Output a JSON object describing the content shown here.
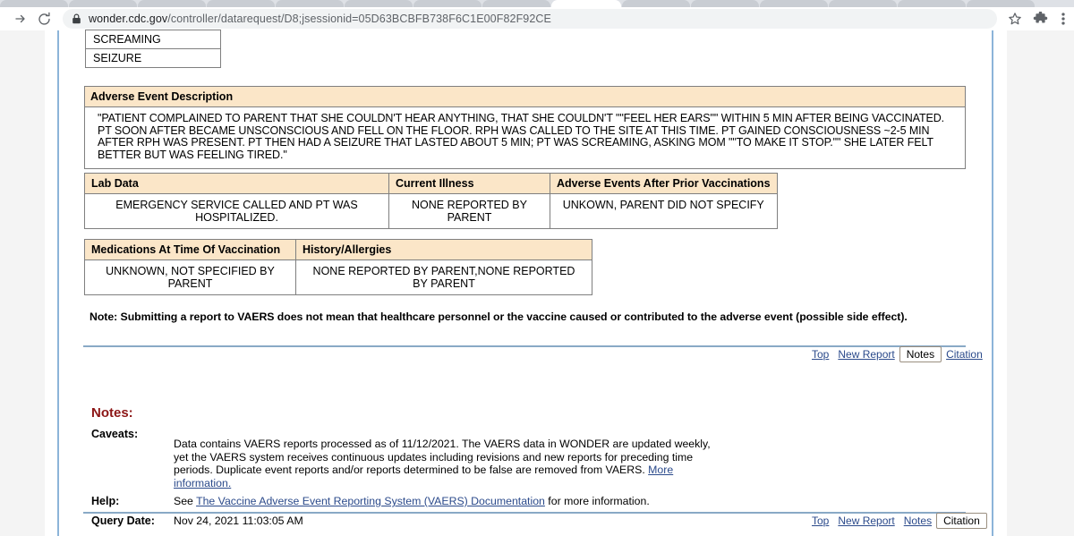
{
  "browser": {
    "url_host": "wonder.cdc.gov",
    "url_path": "/controller/datarequest/D8;jsessionid=05D63BCBFB738F6C1E00F82F92CE",
    "lock_icon": "lock-icon",
    "back_icon": "back-arrow-icon",
    "forward_icon": "forward-arrow-icon",
    "reload_icon": "reload-icon",
    "bookmark_icon": "star-icon",
    "extensions_icon": "puzzle-piece-icon",
    "menu_icon": "three-dot-menu-icon"
  },
  "symptoms_table": {
    "rows": [
      "SCREAMING",
      "SEIZURE"
    ]
  },
  "adverse_event": {
    "header": "Adverse Event Description",
    "text": "\"PATIENT COMPLAINED TO PARENT THAT SHE COULDN'T HEAR ANYTHING, THAT SHE COULDN'T \"\"FEEL HER EARS\"\" WITHIN 5 MIN AFTER BEING VACCINATED. PT SOON AFTER BECAME UNSCONSCIOUS AND FELL ON THE FLOOR. RPH WAS CALLED TO THE SITE AT THIS TIME. PT GAINED CONSCIOUSNESS ~2-5 MIN AFTER RPH WAS PRESENT. PT THEN HAD A SEIZURE THAT LASTED ABOUT 5 MIN; PT WAS SCREAMING, ASKING MOM \"\"TO MAKE IT STOP.\"\" SHE LATER FELT BETTER BUT WAS FEELING TIRED.\""
  },
  "lab_table": {
    "headers": [
      "Lab Data",
      "Current Illness",
      "Adverse Events After Prior Vaccinations"
    ],
    "row": [
      "EMERGENCY SERVICE CALLED AND PT WAS HOSPITALIZED.",
      "NONE REPORTED BY PARENT",
      "UNKOWN, PARENT DID NOT SPECIFY"
    ]
  },
  "meds_table": {
    "headers": [
      "Medications At Time Of Vaccination",
      "History/Allergies"
    ],
    "row": [
      "UNKNOWN, NOT SPECIFIED BY PARENT",
      "NONE REPORTED BY PARENT,NONE REPORTED BY PARENT"
    ]
  },
  "vaers_note": "Note: Submitting a report to VAERS does not mean that healthcare personnel or the vaccine caused or contributed to the adverse event (possible side effect).",
  "nav_top": {
    "top": "Top",
    "new_report": "New Report",
    "notes": "Notes",
    "citation": "Citation"
  },
  "nav_bottom": {
    "top": "Top",
    "new_report": "New Report",
    "notes": "Notes",
    "citation": "Citation"
  },
  "notes": {
    "heading": "Notes:",
    "caveats_label": "Caveats:",
    "caveats_text_part1": "Data contains VAERS reports processed as of 11/12/2021. The VAERS data in WONDER are updated weekly, yet the VAERS system receives continuous updates including revisions and new reports for preceding time periods. Duplicate event reports and/or reports determined to be false are removed from VAERS. ",
    "caveats_link": "More information.",
    "help_label": "Help:",
    "help_prefix": "See ",
    "help_link": "The Vaccine Adverse Event Reporting System (VAERS) Documentation",
    "help_suffix": " for more information.",
    "query_label": "Query Date:",
    "query_value": "Nov 24, 2021 11:03:05 AM"
  },
  "colors": {
    "table_header_bg": "#fbe6c8",
    "rule_blue": "#89a9c6",
    "link_blue": "#2b4a8b",
    "notes_heading": "#8c1616"
  }
}
